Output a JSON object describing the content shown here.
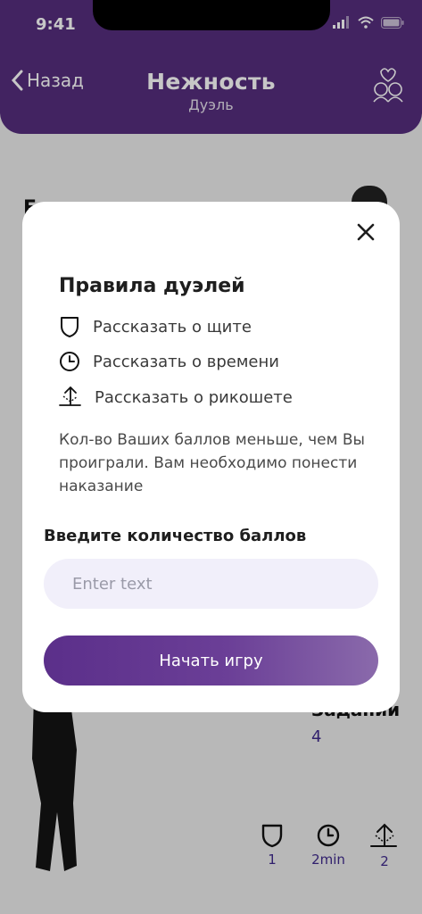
{
  "status_bar": {
    "time": "9:41"
  },
  "header": {
    "back_label": "Назад",
    "title": "Нежность",
    "subtitle": "Дуэль"
  },
  "background": {
    "partial_letter": "Е",
    "tasks_label": "Задании",
    "tasks_count": "4",
    "stats": [
      {
        "icon": "shield-icon",
        "value": "1"
      },
      {
        "icon": "clock-icon",
        "value": "2min"
      },
      {
        "icon": "ricochet-icon",
        "value": "2"
      }
    ]
  },
  "modal": {
    "title": "Правила дуэлей",
    "rules": [
      {
        "icon": "shield-icon",
        "label": "Рассказать о щите"
      },
      {
        "icon": "clock-icon",
        "label": "Рассказать о времени"
      },
      {
        "icon": "ricochet-icon",
        "label": "Рассказать о рикошете"
      }
    ],
    "description": "Кол-во Ваших баллов меньше, чем Вы проиграли. Вам необходимо понести наказание",
    "input_label": "Введите количество баллов",
    "input_placeholder": "Enter text",
    "input_value": "",
    "start_button": "Начать игру"
  },
  "colors": {
    "header": "#552e7d",
    "accent": "#3f2a8c",
    "field_bg": "#f1effa",
    "button_start": "#5b2f8a",
    "button_end": "#8a6aab"
  }
}
